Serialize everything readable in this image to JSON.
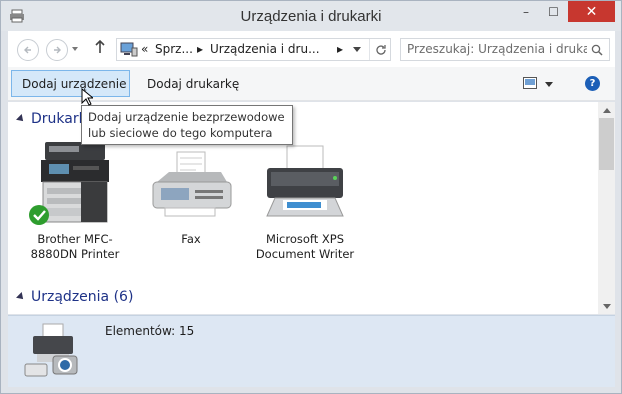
{
  "window": {
    "title": "Urządzenia i drukarki",
    "min_label": "–",
    "max_label": "☐",
    "close_label": "✕"
  },
  "address": {
    "crumbs": [
      "«",
      "Sprz...",
      "▸",
      "Urządzenia i dru...",
      "▸"
    ],
    "search_placeholder": "Przeszukaj: Urządzenia i druka..."
  },
  "toolbar": {
    "add_device": "Dodaj urządzenie",
    "add_printer": "Dodaj drukarkę",
    "help": "?"
  },
  "groups": {
    "printers": "Drukarki",
    "devices": "Urządzenia (6)"
  },
  "printers": [
    {
      "label": "Brother MFC-8880DN Printer",
      "default": true
    },
    {
      "label": "Fax"
    },
    {
      "label": "Microsoft XPS Document Writer"
    }
  ],
  "tooltip": "Dodaj urządzenie bezprzewodowe lub sieciowe do tego komputera",
  "details": {
    "count": "Elementów: 15"
  },
  "colors": {
    "accent": "#1e3287",
    "selected_bg": "#d5e8f9",
    "close": "#c7372f"
  }
}
